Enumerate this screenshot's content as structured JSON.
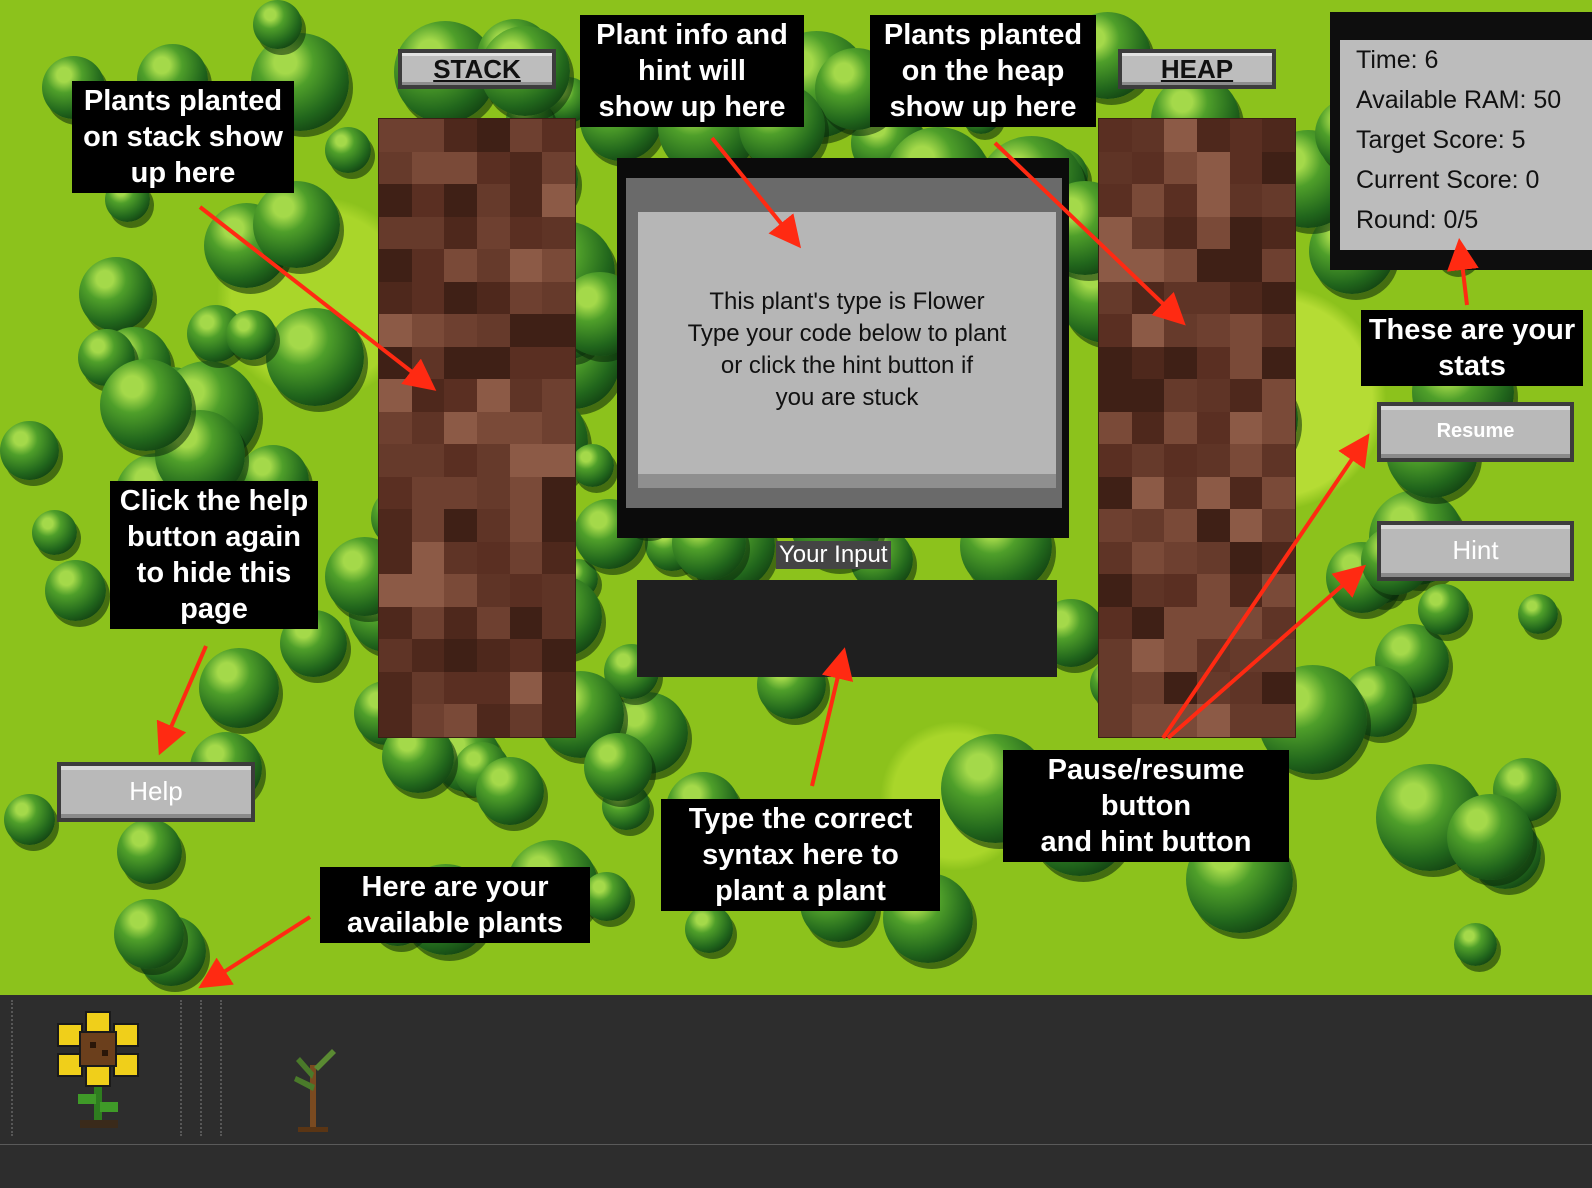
{
  "labels": {
    "stack": "STACK",
    "heap": "HEAP",
    "your_input": "Your Input"
  },
  "info_panel": {
    "lines": [
      "This plant's type is Flower",
      "Type your code below to plant",
      "or click the hint button if",
      "you are stuck"
    ]
  },
  "input": {
    "value": "",
    "placeholder": ""
  },
  "stats": {
    "time": "Time: 6",
    "available_ram": "Available RAM: 50",
    "target_score": "Target Score: 5",
    "current_score": "Current Score: 0",
    "round": "Round: 0/5"
  },
  "buttons": {
    "resume": "Resume",
    "hint": "Hint",
    "help": "Help"
  },
  "callouts": {
    "stack_info": [
      "Plants planted",
      "on stack show",
      "up here"
    ],
    "plant_info": [
      "Plant info and",
      "hint will",
      "show up here"
    ],
    "heap_info": [
      "Plants planted",
      "on the heap",
      "show up here"
    ],
    "stats_info": [
      "These are your",
      "stats"
    ],
    "help_info": [
      "Click the help",
      "button again",
      "to hide this",
      "page"
    ],
    "pause_info": [
      "Pause/resume",
      "button",
      "and hint button"
    ],
    "input_info": [
      "Type the correct",
      "syntax here to",
      "plant a plant"
    ],
    "plants_info": [
      "Here are your",
      "available plants"
    ]
  },
  "plants": [
    {
      "name": "sunflower",
      "icon": "flower-icon"
    },
    {
      "name": "sapling",
      "icon": "sapling-icon"
    }
  ],
  "colors": {
    "callout_bg": "#000000",
    "arrow": "#ff2a12",
    "grass": "#8cc21c",
    "soil": "#5a2f22",
    "panel_gray": "#b6b6b6",
    "tray": "#2d2d2d"
  }
}
